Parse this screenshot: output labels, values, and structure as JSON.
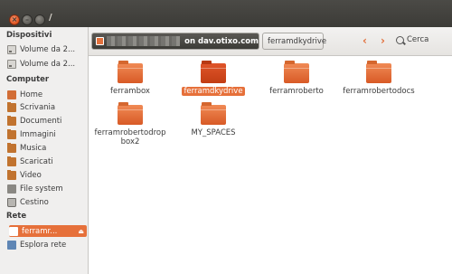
{
  "window": {
    "title": "/"
  },
  "sidebar": {
    "sections": {
      "devices": "Dispositivi",
      "computer": "Computer",
      "network": "Rete"
    },
    "devices": [
      {
        "label": "Volume da 2...",
        "icon": "drive-icon"
      },
      {
        "label": "Volume da 2...",
        "icon": "drive-icon"
      }
    ],
    "computer": [
      {
        "label": "Home",
        "icon": "home-icon"
      },
      {
        "label": "Scrivania",
        "icon": "folder-icon"
      },
      {
        "label": "Documenti",
        "icon": "folder-icon"
      },
      {
        "label": "Immagini",
        "icon": "folder-icon"
      },
      {
        "label": "Musica",
        "icon": "folder-icon"
      },
      {
        "label": "Scaricati",
        "icon": "folder-icon"
      },
      {
        "label": "Video",
        "icon": "folder-icon"
      },
      {
        "label": "File system",
        "icon": "drive-icon"
      },
      {
        "label": "Cestino",
        "icon": "trash-icon"
      }
    ],
    "network": [
      {
        "label": "ferramr...",
        "icon": "network-drive-icon",
        "selected": true,
        "eject": "⏏"
      },
      {
        "label": "Esplora rete",
        "icon": "network-icon"
      }
    ]
  },
  "toolbar": {
    "path_host": "on dav.otixo.com",
    "path_current": "ferramdkydrive",
    "back": "‹",
    "forward": "›",
    "search_label": "Cerca"
  },
  "files": [
    {
      "name": "ferrambox"
    },
    {
      "name": "ferramdkydrive",
      "selected": true
    },
    {
      "name": "ferramroberto"
    },
    {
      "name": "ferramrobertodocs"
    },
    {
      "name": "ferramrobertodropbox2"
    },
    {
      "name": "MY_SPACES"
    }
  ],
  "file_labels": {
    "f4_line1": "ferramrobertodrop",
    "f4_line2": "box2"
  },
  "colors": {
    "accent": "#e6703a",
    "titlebar": "#3c3b37",
    "sidebar": "#f0efee",
    "content": "#ffffff"
  }
}
